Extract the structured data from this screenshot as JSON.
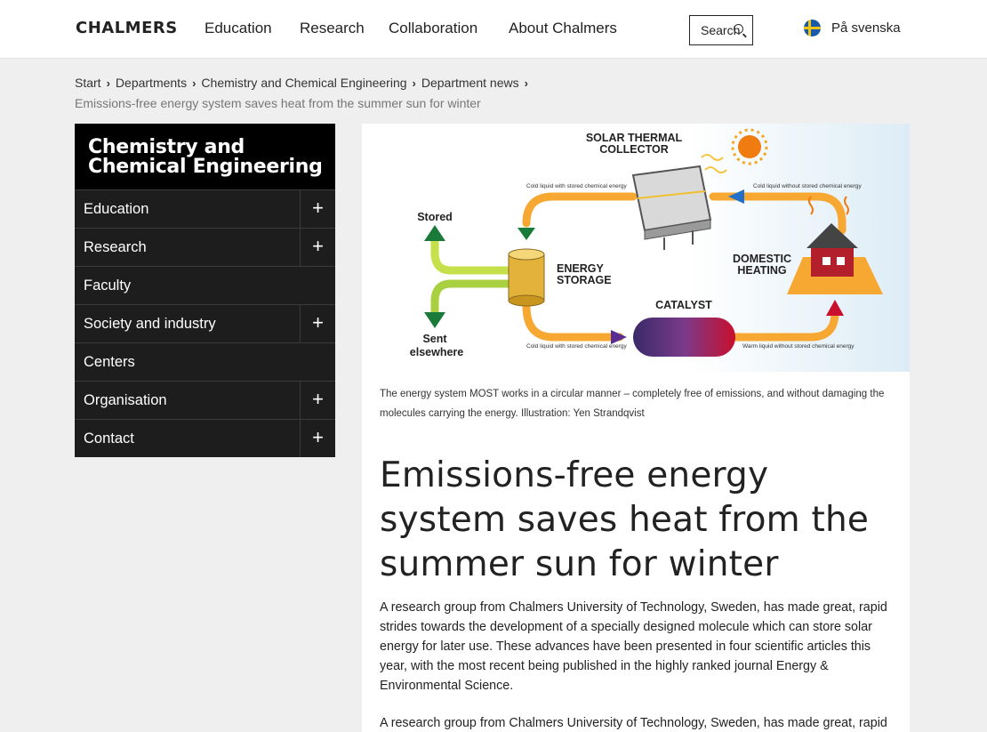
{
  "header": {
    "logo": "CHALMERS",
    "nav": [
      "Education",
      "Research",
      "Collaboration",
      "About Chalmers"
    ],
    "search_label": "Search",
    "language": "På svenska"
  },
  "breadcrumb": {
    "items": [
      "Start",
      "Departments",
      "Chemistry and Chemical Engineering",
      "Department news"
    ],
    "current": "Emissions-free energy system saves heat from the summer sun for winter"
  },
  "sidebar": {
    "title_line1": "Chemistry and",
    "title_line2": "Chemical Engineering",
    "items": [
      {
        "label": "Education",
        "expandable": true
      },
      {
        "label": "Research",
        "expandable": true
      },
      {
        "label": "Faculty",
        "expandable": false
      },
      {
        "label": "Society and industry",
        "expandable": true
      },
      {
        "label": "Centers",
        "expandable": false
      },
      {
        "label": "Organisation",
        "expandable": true
      },
      {
        "label": "Contact",
        "expandable": true
      }
    ],
    "expand_symbol": "+"
  },
  "figure": {
    "labels": {
      "solar_l1": "SOLAR THERMAL",
      "solar_l2": "COLLECTOR",
      "storage_l1": "ENERGY",
      "storage_l2": "STORAGE",
      "catalyst": "CATALYST",
      "heating_l1": "DOMESTIC",
      "heating_l2": "HEATING",
      "stored": "Stored",
      "sent_l1": "Sent",
      "sent_l2": "elsewhere",
      "flow_top_left": "Cold liquid with stored chemical energy",
      "flow_top_right": "Cold liquid without stored chemical energy",
      "flow_bottom_left": "Cold liquid with stored chemical energy",
      "flow_bottom_right": "Warm liquid without stored chemical energy"
    }
  },
  "article": {
    "caption": "The energy system MOST works in a circular manner – completely free of emissions, and without damaging the molecules carrying the energy.  Illustration: Yen Strandqvist",
    "headline": "Emissions-free energy system saves heat from the summer sun for winter",
    "lede": "A research group from Chalmers University of Technology, Sweden, has made great, rapid strides towards the development of a specially designed molecule which can store solar energy for later use. These advances have been presented in four scientific articles this year, with the most recent being published in the highly ranked journal Energy & Environmental Science.",
    "body_start": "A research group from Chalmers University of Technology, Sweden, has made great, rapid"
  },
  "colors": {
    "flow_orange": "#f7a833",
    "arrow_green": "#1a7a3a",
    "arrow_blue": "#2470c8",
    "arrow_purple": "#5a2d91",
    "arrow_red": "#c8102e",
    "sidebar_bg": "#1d1d1d",
    "sidebar_title_bg": "#000000"
  }
}
